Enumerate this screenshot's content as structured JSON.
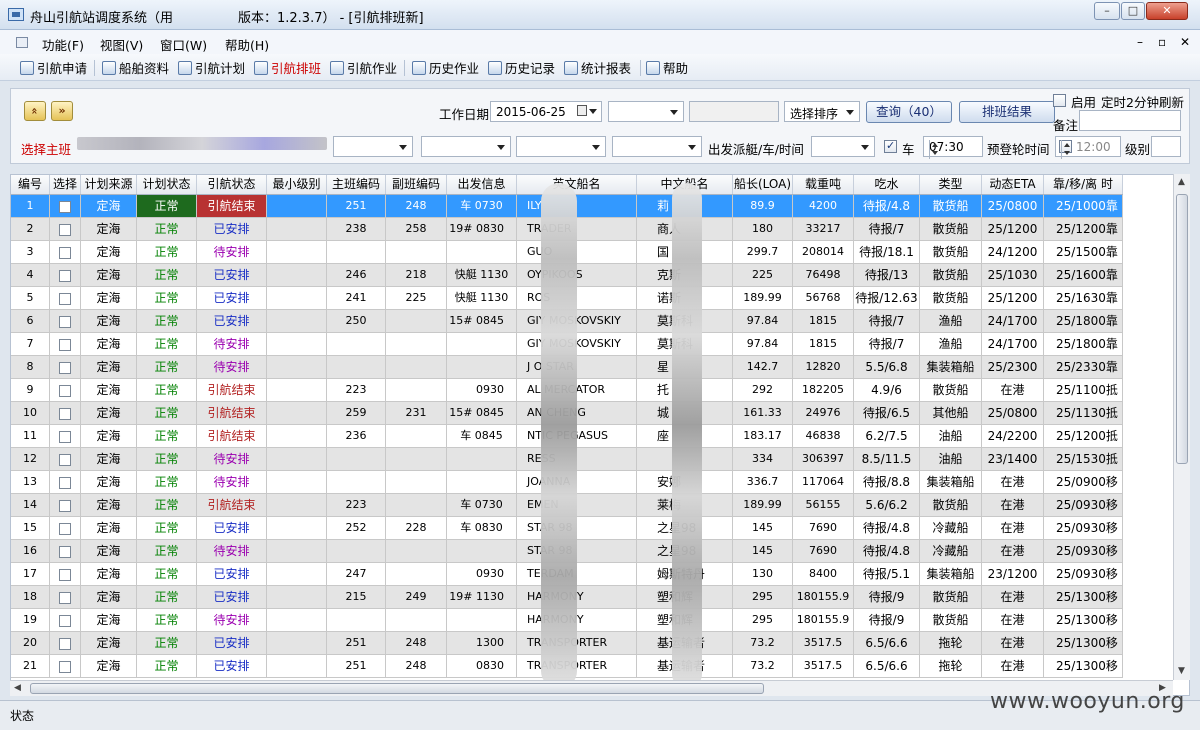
{
  "window": {
    "title": "舟山引航站调度系统（用　　　　　版本：1.2.3.7） - [引航排班新]",
    "min": "–",
    "max": "□",
    "close": "✕"
  },
  "menu": {
    "items": [
      "功能(F)",
      "视图(V)",
      "窗口(W)",
      "帮助(H)"
    ],
    "mdi": [
      "–",
      "▫",
      "✕"
    ]
  },
  "toolbar": {
    "items": [
      {
        "label": "引航申请",
        "icon": "apply-icon"
      },
      {
        "label": "船舶资料",
        "icon": "ship-data-icon"
      },
      {
        "label": "引航计划",
        "icon": "plan-icon"
      },
      {
        "label": "引航排班",
        "icon": "schedule-icon"
      },
      {
        "label": "引航作业",
        "icon": "operation-icon"
      },
      {
        "label": "历史作业",
        "icon": "history-op-icon"
      },
      {
        "label": "历史记录",
        "icon": "history-record-icon"
      },
      {
        "label": "统计报表",
        "icon": "report-icon"
      },
      {
        "label": "帮助",
        "icon": "help-icon"
      }
    ]
  },
  "filters": {
    "work_date_label": "工作日期",
    "work_date_value": "2015-06-25",
    "sort_label": "选择排序",
    "query_button": "查询（40）",
    "schedule_result_button": "排班结果",
    "enable_label": "启用",
    "refresh_label": "定时2分钟刷新",
    "remark_label": "备注",
    "main_shift_label": "选择主班",
    "depart_label": "出发派艇/车/时间",
    "car_label": "车",
    "car_time": "07:30",
    "arrival_label": "预登轮时间",
    "arrival_time": "12:00",
    "level_label": "级别",
    "prev_icon": "»",
    "next_icon": "»"
  },
  "table": {
    "headers": [
      "编号",
      "选择",
      "计划来源",
      "计划状态",
      "引航状态",
      "最小级别",
      "主班编码",
      "副班编码",
      "出发信息",
      "英文船名",
      "中文船名",
      "船长(LOA)",
      "载重吨",
      "吃水",
      "类型",
      "动态ETA",
      "靠/移/离 时"
    ],
    "rows": [
      [
        "1",
        "",
        "定海",
        "正常",
        "引航结束",
        "",
        "251",
        "248",
        "车 0730",
        "ILY",
        "莉",
        "89.9",
        "4200",
        "待报/4.8",
        "散货船",
        "25/0800",
        "25/1000靠"
      ],
      [
        "2",
        "",
        "定海",
        "正常",
        "已安排",
        "",
        "238",
        "258",
        "19# 0830",
        "TRADER",
        "商人",
        "180",
        "33217",
        "待报/7",
        "散货船",
        "25/1200",
        "25/1200靠"
      ],
      [
        "3",
        "",
        "定海",
        "正常",
        "待安排",
        "",
        "",
        "",
        "",
        "GUO",
        "国",
        "299.7",
        "208014",
        "待报/18.1",
        "散货船",
        "24/1200",
        "25/1500靠"
      ],
      [
        "4",
        "",
        "定海",
        "正常",
        "已安排",
        "",
        "246",
        "218",
        "快艇 1130",
        "OYPIKOOS",
        "克斯",
        "225",
        "76498",
        "待报/13",
        "散货船",
        "25/1030",
        "25/1600靠"
      ],
      [
        "5",
        "",
        "定海",
        "正常",
        "已安排",
        "",
        "241",
        "225",
        "快艇 1130",
        "ROS",
        "诺斯",
        "189.99",
        "56768",
        "待报/12.63",
        "散货船",
        "25/1200",
        "25/1630靠"
      ],
      [
        "6",
        "",
        "定海",
        "正常",
        "已安排",
        "",
        "250",
        "",
        "15# 0845",
        "GIY MOSKOVSKIY",
        "莫斯科",
        "97.84",
        "1815",
        "待报/7",
        "渔船",
        "24/1700",
        "25/1800靠"
      ],
      [
        "7",
        "",
        "定海",
        "正常",
        "待安排",
        "",
        "",
        "",
        "",
        "GIY MOSKOVSKIY",
        "莫斯科",
        "97.84",
        "1815",
        "待报/7",
        "渔船",
        "24/1700",
        "25/1800靠"
      ],
      [
        "8",
        "",
        "定海",
        "正常",
        "待安排",
        "",
        "",
        "",
        "",
        "J  O STAR",
        "星",
        "142.7",
        "12820",
        "5.5/6.8",
        "集装箱船",
        "25/2300",
        "25/2330靠"
      ],
      [
        "9",
        "",
        "定海",
        "正常",
        "引航结束",
        "",
        "223",
        "",
        "0930",
        "AL MERCATOR",
        "托",
        "292",
        "182205",
        "4.9/6",
        "散货船",
        "在港",
        "25/1100抵"
      ],
      [
        "10",
        "",
        "定海",
        "正常",
        "引航结束",
        "",
        "259",
        "231",
        "15# 0845",
        "AN CHENG",
        "城",
        "161.33",
        "24976",
        "待报/6.5",
        "其他船",
        "25/0800",
        "25/1130抵"
      ],
      [
        "11",
        "",
        "定海",
        "正常",
        "引航结束",
        "",
        "236",
        "",
        "车 0845",
        "NTIC PEGASUS",
        "座",
        "183.17",
        "46838",
        "6.2/7.5",
        "油船",
        "24/2200",
        "25/1200抵"
      ],
      [
        "12",
        "",
        "定海",
        "正常",
        "待安排",
        "",
        "",
        "",
        "",
        "RESS",
        "",
        "334",
        "306397",
        "8.5/11.5",
        "油船",
        "23/1400",
        "25/1530抵"
      ],
      [
        "13",
        "",
        "定海",
        "正常",
        "待安排",
        "",
        "",
        "",
        "",
        "JOANNA",
        "安娜",
        "336.7",
        "117064",
        "待报/8.8",
        "集装箱船",
        "在港",
        "25/0900移"
      ],
      [
        "14",
        "",
        "定海",
        "正常",
        "引航结束",
        "",
        "223",
        "",
        "车 0730",
        "EMEN",
        "莱梅",
        "189.99",
        "56155",
        "5.6/6.2",
        "散货船",
        "在港",
        "25/0930移"
      ],
      [
        "15",
        "",
        "定海",
        "正常",
        "已安排",
        "",
        "252",
        "228",
        "车 0830",
        "STAR 98",
        "之星98",
        "145",
        "7690",
        "待报/4.8",
        "冷藏船",
        "在港",
        "25/0930移"
      ],
      [
        "16",
        "",
        "定海",
        "正常",
        "待安排",
        "",
        "",
        "",
        "",
        "STAR 98",
        "之星98",
        "145",
        "7690",
        "待报/4.8",
        "冷藏船",
        "在港",
        "25/0930移"
      ],
      [
        "17",
        "",
        "定海",
        "正常",
        "已安排",
        "",
        "247",
        "",
        "0930",
        "TERDAM",
        "姆斯特丹",
        "130",
        "8400",
        "待报/5.1",
        "集装箱船",
        "23/1200",
        "25/0930移"
      ],
      [
        "18",
        "",
        "定海",
        "正常",
        "已安排",
        "",
        "215",
        "249",
        "19# 1130",
        "HARMONY",
        "塑和辉",
        "295",
        "180155.9",
        "待报/9",
        "散货船",
        "在港",
        "25/1300移"
      ],
      [
        "19",
        "",
        "定海",
        "正常",
        "待安排",
        "",
        "",
        "",
        "",
        "HARMONY",
        "塑和辉",
        "295",
        "180155.9",
        "待报/9",
        "散货船",
        "在港",
        "25/1300移"
      ],
      [
        "20",
        "",
        "定海",
        "正常",
        "已安排",
        "",
        "251",
        "248",
        "1300",
        "TRANSPORTER",
        "基运输者",
        "73.2",
        "3517.5",
        "6.5/6.6",
        "拖轮",
        "在港",
        "25/1300移"
      ],
      [
        "21",
        "",
        "定海",
        "正常",
        "已安排",
        "",
        "251",
        "248",
        "0830",
        "TRANSPORTER",
        "基运输者",
        "73.2",
        "3517.5",
        "6.5/6.6",
        "拖轮",
        "在港",
        "25/1300移"
      ]
    ]
  },
  "status": {
    "text": "状态"
  },
  "watermark": "www.wooyun.org"
}
